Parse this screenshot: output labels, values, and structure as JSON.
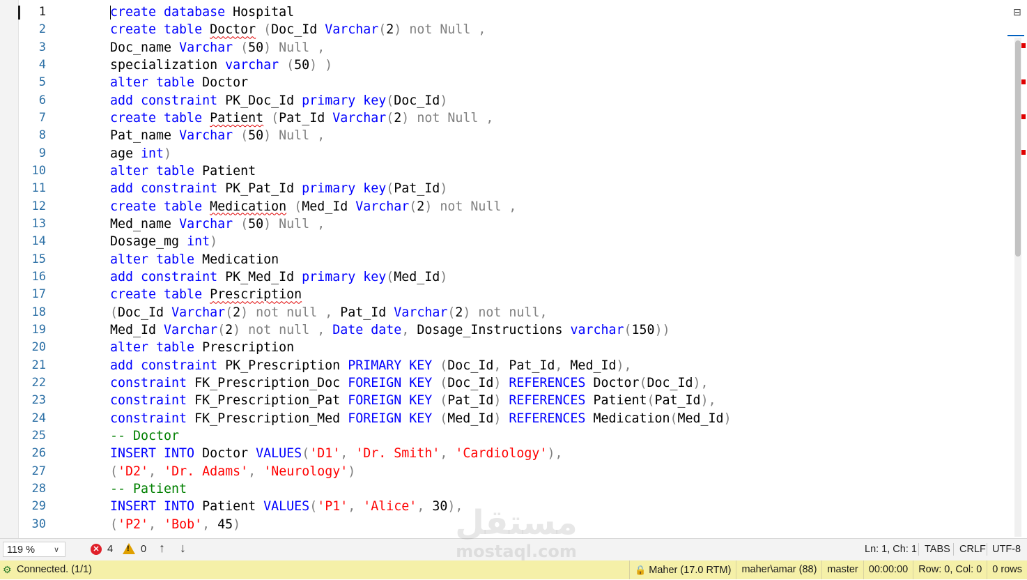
{
  "editor": {
    "line_numbers": [
      "1",
      "2",
      "3",
      "4",
      "5",
      "6",
      "7",
      "8",
      "9",
      "10",
      "11",
      "12",
      "13",
      "14",
      "15",
      "16",
      "17",
      "18",
      "19",
      "20",
      "21",
      "22",
      "23",
      "24",
      "25",
      "26",
      "27",
      "28",
      "29",
      "30"
    ],
    "lines": [
      [
        {
          "t": "create database",
          "c": "k"
        },
        {
          "t": " Hospital"
        }
      ],
      [
        {
          "t": "create table",
          "c": "k"
        },
        {
          "t": " "
        },
        {
          "t": "Doctor",
          "c": "u"
        },
        {
          "t": " "
        },
        {
          "t": "(",
          "c": "g"
        },
        {
          "t": "Doc_Id "
        },
        {
          "t": "Varchar",
          "c": "k"
        },
        {
          "t": "(",
          "c": "g"
        },
        {
          "t": "2"
        },
        {
          "t": ")",
          "c": "g"
        },
        {
          "t": " not Null ,",
          "c": "g"
        }
      ],
      [
        {
          "t": "Doc_name "
        },
        {
          "t": "Varchar",
          "c": "k"
        },
        {
          "t": " (",
          "c": "g"
        },
        {
          "t": "50"
        },
        {
          "t": ")",
          "c": "g"
        },
        {
          "t": " Null ,",
          "c": "g"
        }
      ],
      [
        {
          "t": "specialization "
        },
        {
          "t": "varchar",
          "c": "k"
        },
        {
          "t": " (",
          "c": "g"
        },
        {
          "t": "50"
        },
        {
          "t": ") )",
          "c": "g"
        }
      ],
      [
        {
          "t": "alter table",
          "c": "k"
        },
        {
          "t": " Doctor"
        }
      ],
      [
        {
          "t": "add constraint",
          "c": "k"
        },
        {
          "t": " PK_Doc_Id "
        },
        {
          "t": "primary key",
          "c": "k"
        },
        {
          "t": "(",
          "c": "g"
        },
        {
          "t": "Doc_Id"
        },
        {
          "t": ")",
          "c": "g"
        }
      ],
      [
        {
          "t": "create table",
          "c": "k"
        },
        {
          "t": " "
        },
        {
          "t": "Patient",
          "c": "u"
        },
        {
          "t": " "
        },
        {
          "t": "(",
          "c": "g"
        },
        {
          "t": "Pat_Id "
        },
        {
          "t": "Varchar",
          "c": "k"
        },
        {
          "t": "(",
          "c": "g"
        },
        {
          "t": "2"
        },
        {
          "t": ")",
          "c": "g"
        },
        {
          "t": " not Null ,",
          "c": "g"
        }
      ],
      [
        {
          "t": "Pat_name "
        },
        {
          "t": "Varchar",
          "c": "k"
        },
        {
          "t": " (",
          "c": "g"
        },
        {
          "t": "50"
        },
        {
          "t": ")",
          "c": "g"
        },
        {
          "t": " Null ,",
          "c": "g"
        }
      ],
      [
        {
          "t": "age "
        },
        {
          "t": "int",
          "c": "k"
        },
        {
          "t": ")",
          "c": "g"
        }
      ],
      [
        {
          "t": "alter table",
          "c": "k"
        },
        {
          "t": " Patient"
        }
      ],
      [
        {
          "t": "add constraint",
          "c": "k"
        },
        {
          "t": " PK_Pat_Id "
        },
        {
          "t": "primary key",
          "c": "k"
        },
        {
          "t": "(",
          "c": "g"
        },
        {
          "t": "Pat_Id"
        },
        {
          "t": ")",
          "c": "g"
        }
      ],
      [
        {
          "t": "create table",
          "c": "k"
        },
        {
          "t": " "
        },
        {
          "t": "Medication",
          "c": "u"
        },
        {
          "t": " "
        },
        {
          "t": "(",
          "c": "g"
        },
        {
          "t": "Med_Id "
        },
        {
          "t": "Varchar",
          "c": "k"
        },
        {
          "t": "(",
          "c": "g"
        },
        {
          "t": "2"
        },
        {
          "t": ")",
          "c": "g"
        },
        {
          "t": " not Null ,",
          "c": "g"
        }
      ],
      [
        {
          "t": "Med_name "
        },
        {
          "t": "Varchar",
          "c": "k"
        },
        {
          "t": " (",
          "c": "g"
        },
        {
          "t": "50"
        },
        {
          "t": ")",
          "c": "g"
        },
        {
          "t": " Null ,",
          "c": "g"
        }
      ],
      [
        {
          "t": "Dosage_mg "
        },
        {
          "t": "int",
          "c": "k"
        },
        {
          "t": ")",
          "c": "g"
        }
      ],
      [
        {
          "t": "alter table",
          "c": "k"
        },
        {
          "t": " Medication"
        }
      ],
      [
        {
          "t": "add constraint",
          "c": "k"
        },
        {
          "t": " PK_Med_Id "
        },
        {
          "t": "primary key",
          "c": "k"
        },
        {
          "t": "(",
          "c": "g"
        },
        {
          "t": "Med_Id"
        },
        {
          "t": ")",
          "c": "g"
        }
      ],
      [
        {
          "t": "create table",
          "c": "k"
        },
        {
          "t": " "
        },
        {
          "t": "Prescription",
          "c": "u"
        }
      ],
      [
        {
          "t": "(",
          "c": "g"
        },
        {
          "t": "Doc_Id "
        },
        {
          "t": "Varchar",
          "c": "k"
        },
        {
          "t": "(",
          "c": "g"
        },
        {
          "t": "2"
        },
        {
          "t": ")",
          "c": "g"
        },
        {
          "t": " not null ,",
          "c": "g"
        },
        {
          "t": " Pat_Id "
        },
        {
          "t": "Varchar",
          "c": "k"
        },
        {
          "t": "(",
          "c": "g"
        },
        {
          "t": "2"
        },
        {
          "t": ")",
          "c": "g"
        },
        {
          "t": " not null,",
          "c": "g"
        }
      ],
      [
        {
          "t": "Med_Id "
        },
        {
          "t": "Varchar",
          "c": "k"
        },
        {
          "t": "(",
          "c": "g"
        },
        {
          "t": "2"
        },
        {
          "t": ")",
          "c": "g"
        },
        {
          "t": " not null ,",
          "c": "g"
        },
        {
          "t": " "
        },
        {
          "t": "Date",
          "c": "k"
        },
        {
          "t": " "
        },
        {
          "t": "date",
          "c": "k"
        },
        {
          "t": ",",
          "c": "g"
        },
        {
          "t": " Dosage_Instructions "
        },
        {
          "t": "varchar",
          "c": "k"
        },
        {
          "t": "(",
          "c": "g"
        },
        {
          "t": "150"
        },
        {
          "t": "))",
          "c": "g"
        }
      ],
      [
        {
          "t": "alter table",
          "c": "k"
        },
        {
          "t": " Prescription"
        }
      ],
      [
        {
          "t": "add constraint",
          "c": "k"
        },
        {
          "t": " PK_Prescription "
        },
        {
          "t": "PRIMARY KEY",
          "c": "k"
        },
        {
          "t": " (",
          "c": "g"
        },
        {
          "t": "Doc_Id"
        },
        {
          "t": ",",
          "c": "g"
        },
        {
          "t": " Pat_Id"
        },
        {
          "t": ",",
          "c": "g"
        },
        {
          "t": " Med_Id"
        },
        {
          "t": "),",
          "c": "g"
        }
      ],
      [
        {
          "t": "constraint",
          "c": "k"
        },
        {
          "t": " FK_Prescription_Doc "
        },
        {
          "t": "FOREIGN KEY",
          "c": "k"
        },
        {
          "t": " (",
          "c": "g"
        },
        {
          "t": "Doc_Id"
        },
        {
          "t": ")",
          "c": "g"
        },
        {
          "t": " "
        },
        {
          "t": "REFERENCES",
          "c": "k"
        },
        {
          "t": " Doctor"
        },
        {
          "t": "(",
          "c": "g"
        },
        {
          "t": "Doc_Id"
        },
        {
          "t": "),",
          "c": "g"
        }
      ],
      [
        {
          "t": "constraint",
          "c": "k"
        },
        {
          "t": " FK_Prescription_Pat "
        },
        {
          "t": "FOREIGN KEY",
          "c": "k"
        },
        {
          "t": " (",
          "c": "g"
        },
        {
          "t": "Pat_Id"
        },
        {
          "t": ")",
          "c": "g"
        },
        {
          "t": " "
        },
        {
          "t": "REFERENCES",
          "c": "k"
        },
        {
          "t": " Patient"
        },
        {
          "t": "(",
          "c": "g"
        },
        {
          "t": "Pat_Id"
        },
        {
          "t": "),",
          "c": "g"
        }
      ],
      [
        {
          "t": "constraint",
          "c": "k"
        },
        {
          "t": " FK_Prescription_Med "
        },
        {
          "t": "FOREIGN KEY",
          "c": "k"
        },
        {
          "t": " (",
          "c": "g"
        },
        {
          "t": "Med_Id"
        },
        {
          "t": ")",
          "c": "g"
        },
        {
          "t": " "
        },
        {
          "t": "REFERENCES",
          "c": "k"
        },
        {
          "t": " Medication"
        },
        {
          "t": "(",
          "c": "g"
        },
        {
          "t": "Med_Id"
        },
        {
          "t": ")",
          "c": "g"
        }
      ],
      [
        {
          "t": "-- Doctor",
          "c": "c"
        }
      ],
      [
        {
          "t": "INSERT INTO",
          "c": "k"
        },
        {
          "t": " Doctor "
        },
        {
          "t": "VALUES",
          "c": "k"
        },
        {
          "t": "(",
          "c": "g"
        },
        {
          "t": "'D1'",
          "c": "s"
        },
        {
          "t": ",",
          "c": "g"
        },
        {
          "t": " "
        },
        {
          "t": "'Dr. Smith'",
          "c": "s"
        },
        {
          "t": ",",
          "c": "g"
        },
        {
          "t": " "
        },
        {
          "t": "'Cardiology'",
          "c": "s"
        },
        {
          "t": "),",
          "c": "g"
        }
      ],
      [
        {
          "t": "(",
          "c": "g"
        },
        {
          "t": "'D2'",
          "c": "s"
        },
        {
          "t": ",",
          "c": "g"
        },
        {
          "t": " "
        },
        {
          "t": "'Dr. Adams'",
          "c": "s"
        },
        {
          "t": ",",
          "c": "g"
        },
        {
          "t": " "
        },
        {
          "t": "'Neurology'",
          "c": "s"
        },
        {
          "t": ")",
          "c": "g"
        }
      ],
      [
        {
          "t": "-- Patient",
          "c": "c"
        }
      ],
      [
        {
          "t": "INSERT INTO",
          "c": "k"
        },
        {
          "t": " Patient "
        },
        {
          "t": "VALUES",
          "c": "k"
        },
        {
          "t": "(",
          "c": "g"
        },
        {
          "t": "'P1'",
          "c": "s"
        },
        {
          "t": ",",
          "c": "g"
        },
        {
          "t": " "
        },
        {
          "t": "'Alice'",
          "c": "s"
        },
        {
          "t": ",",
          "c": "g"
        },
        {
          "t": " 30"
        },
        {
          "t": "),",
          "c": "g"
        }
      ],
      [
        {
          "t": "(",
          "c": "g"
        },
        {
          "t": "'P2'",
          "c": "s"
        },
        {
          "t": ",",
          "c": "g"
        },
        {
          "t": " "
        },
        {
          "t": "'Bob'",
          "c": "s"
        },
        {
          "t": ",",
          "c": "g"
        },
        {
          "t": " 45"
        },
        {
          "t": ")",
          "c": "g"
        }
      ]
    ]
  },
  "status": {
    "zoom": "119 %",
    "errors": "4",
    "warnings": "0",
    "position": "Ln: 1, Ch: 1",
    "tabs": "TABS",
    "eol": "CRLF",
    "encoding": "UTF-8"
  },
  "connection": {
    "status": "Connected. (1/1)",
    "server": "Maher (17.0 RTM)",
    "user": "maher\\amar (88)",
    "database": "master",
    "elapsed": "00:00:00",
    "rowcol": "Row: 0, Col: 0",
    "rows": "0 rows"
  },
  "watermark": {
    "arabic": "مستقل",
    "latin": "mostaql.com"
  },
  "colors": {
    "keyword": "#0000ff",
    "operator": "#808080",
    "string": "#ff0000",
    "comment": "#008000",
    "statusbar": "#f3f3f3",
    "connbar": "#f5f0a8"
  }
}
